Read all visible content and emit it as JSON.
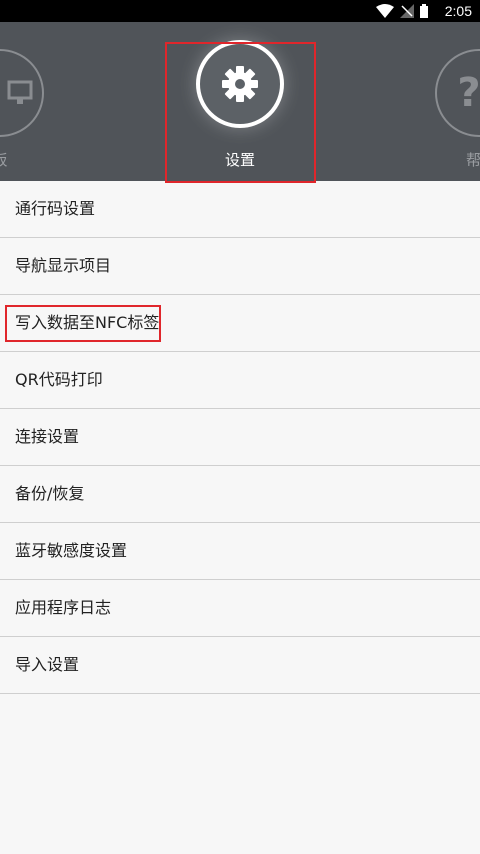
{
  "status_bar": {
    "time": "2:05",
    "icons": [
      "wifi-icon",
      "no-signal-icon",
      "battery-icon"
    ]
  },
  "header": {
    "left_item": {
      "label": "板",
      "icon": "monitor-icon"
    },
    "center_item": {
      "label": "设置",
      "icon": "gear-icon"
    },
    "right_item": {
      "label": "帮",
      "icon": "help-icon"
    }
  },
  "menu": {
    "items": [
      {
        "label": "通行码设置"
      },
      {
        "label": "导航显示项目"
      },
      {
        "label": "写入数据至NFC标签"
      },
      {
        "label": "QR代码打印"
      },
      {
        "label": "连接设置"
      },
      {
        "label": "备份/恢复"
      },
      {
        "label": "蓝牙敏感度设置"
      },
      {
        "label": "应用程序日志"
      },
      {
        "label": "导入设置"
      }
    ]
  },
  "colors": {
    "header_bg": "#505459",
    "highlight": "#e0262b",
    "list_bg": "#f7f7f7"
  }
}
